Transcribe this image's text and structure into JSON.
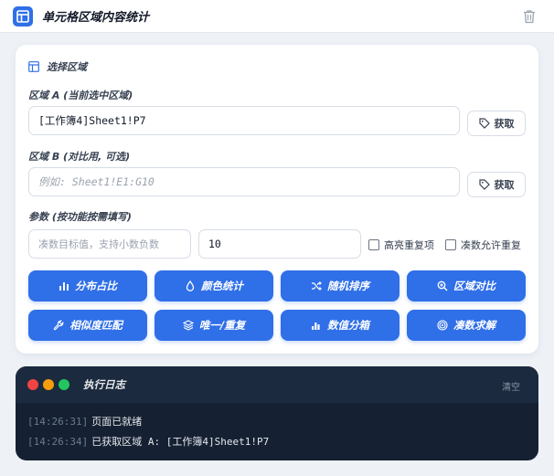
{
  "header": {
    "title": "单元格区域内容统计"
  },
  "selection": {
    "heading": "选择区域",
    "area_a": {
      "label": "区域 A (当前选中区域)",
      "value": "[工作簿4]Sheet1!P7",
      "fetch_label": "获取"
    },
    "area_b": {
      "label": "区域 B (对比用, 可选)",
      "placeholder": "例如: Sheet1!E1:G10",
      "fetch_label": "获取"
    },
    "params": {
      "label": "参数 (按功能按需填写)",
      "target_placeholder": "凑数目标值，支持小数负数",
      "count_value": "10",
      "highlight_dup_label": "高亮重复项",
      "allow_dup_label": "凑数允许重复"
    }
  },
  "actions": [
    {
      "label": "分布占比",
      "icon": "bar-chart-icon"
    },
    {
      "label": "颜色统计",
      "icon": "droplet-icon"
    },
    {
      "label": "随机排序",
      "icon": "shuffle-icon"
    },
    {
      "label": "区域对比",
      "icon": "zoom-icon"
    },
    {
      "label": "相似度匹配",
      "icon": "wrench-icon"
    },
    {
      "label": "唯一/重复",
      "icon": "layers-icon"
    },
    {
      "label": "数值分箱",
      "icon": "histogram-icon"
    },
    {
      "label": "凑数求解",
      "icon": "target-icon"
    }
  ],
  "log": {
    "title": "执行日志",
    "clear_label": "清空",
    "lines": [
      {
        "time": "[14:26:31]",
        "text": "页面已就绪"
      },
      {
        "time": "[14:26:34]",
        "text": "已获取区域 A: [工作簿4]Sheet1!P7"
      }
    ]
  },
  "colors": {
    "accent": "#2f6fe8",
    "log_bg": "#152132",
    "dot_red": "#ef4444",
    "dot_yellow": "#f59e0b",
    "dot_green": "#22c55e"
  }
}
